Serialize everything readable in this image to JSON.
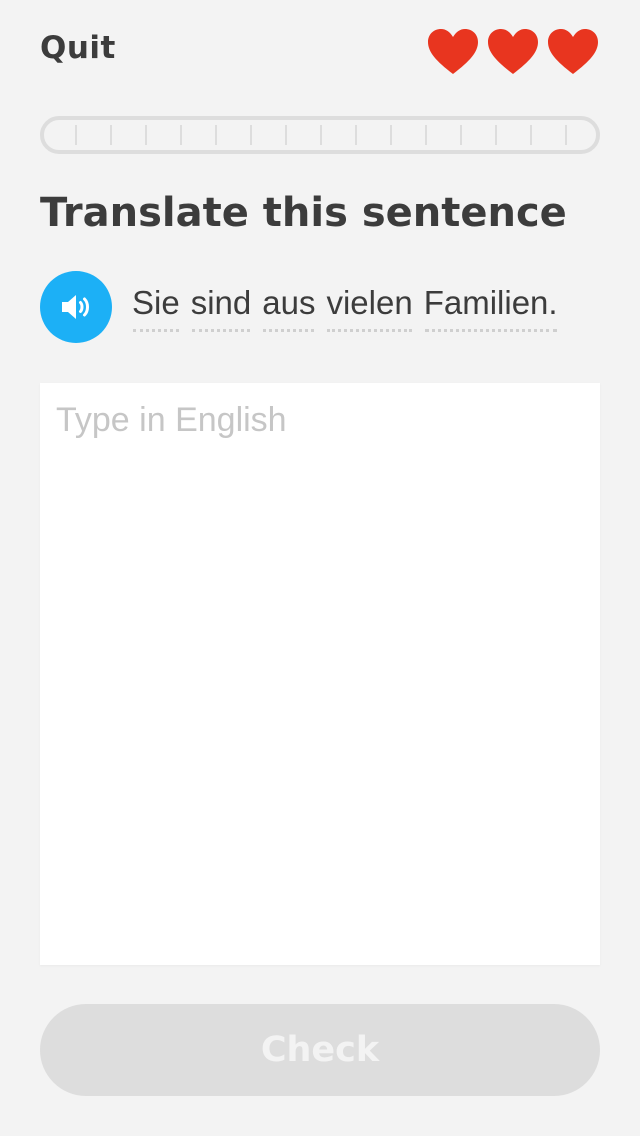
{
  "header": {
    "quit_label": "Quit",
    "hearts": [
      "heart-icon",
      "heart-icon",
      "heart-icon"
    ],
    "heart_color": "#e8351f"
  },
  "progress": {
    "value": 0,
    "segments": 15
  },
  "prompt": {
    "title": "Translate this sentence",
    "speaker_icon": "speaker-icon",
    "speaker_color": "#1cb0f6",
    "words": [
      "Sie",
      "sind",
      "aus",
      "vielen",
      "Familien."
    ]
  },
  "answer": {
    "placeholder": "Type in English",
    "value": ""
  },
  "footer": {
    "check_label": "Check",
    "check_enabled": false
  }
}
